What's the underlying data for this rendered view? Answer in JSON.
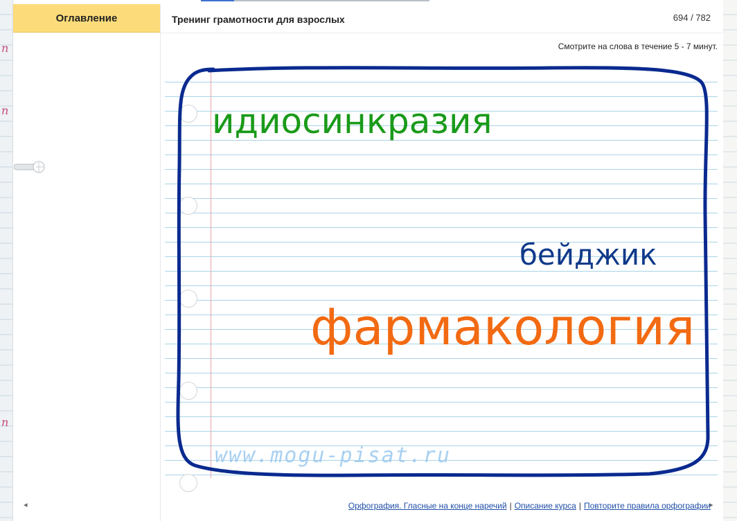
{
  "toc": {
    "label": "Оглавление"
  },
  "header": {
    "course_title": "Тренинг грамотности для взрослых",
    "page_counter": "694 / 782"
  },
  "instruction": "Смотрите на слова в течение 5 - 7 минут.",
  "words": [
    {
      "text": "идиосинкразия",
      "color": "#1a9a1a"
    },
    {
      "text": "бейджик",
      "color": "#103a8a"
    },
    {
      "text": "фармакология",
      "color": "#f26a12"
    }
  ],
  "watermark": "www.mogu-pisat.ru",
  "footer": {
    "prev_arrow": "◂",
    "next_arrow": "▸",
    "links": [
      "Орфография. Гласные на конце наречий",
      "Описание курса",
      "Повторите правила орфографии"
    ]
  },
  "colors": {
    "toc_tab": "#fcdc7a",
    "frame": "#0a2a8f",
    "notebook_line": "#a8d4e6",
    "margin_line": "#e9a2a8"
  }
}
